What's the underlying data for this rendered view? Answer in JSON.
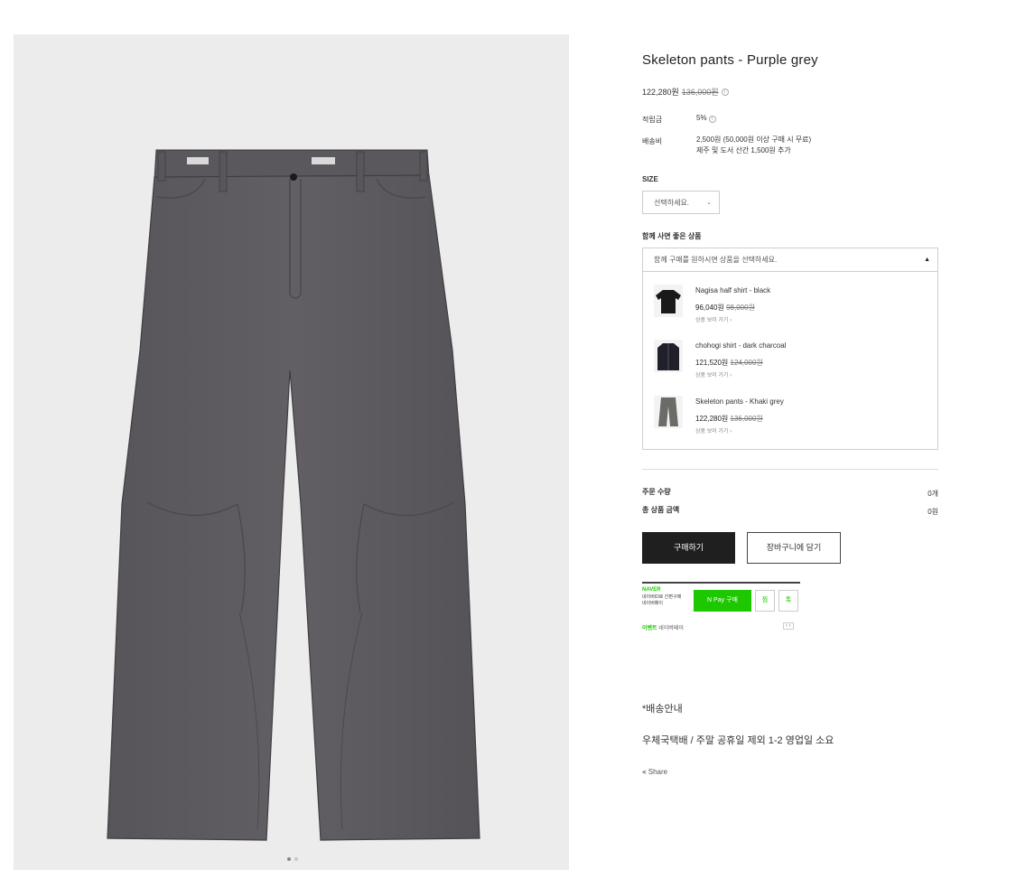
{
  "product": {
    "title": "Skeleton pants - Purple grey",
    "price": "122,280원",
    "original_price": "136,000원",
    "info_mark": "i"
  },
  "meta": {
    "points_label": "적립금",
    "points_value": "5%",
    "shipping_label": "배송비",
    "shipping_line1": "2,500원 (50,000원 이상 구매 시 무료)",
    "shipping_line2": "제주 및 도서 산간 1,500원 추가"
  },
  "size": {
    "label": "SIZE",
    "placeholder": "선택하세요.",
    "chevron": "⌄"
  },
  "related": {
    "label": "함께 사면 좋은 상품",
    "prompt": "함께 구매를 원하시면 상품을 선택하세요.",
    "toggle": "▲",
    "items": [
      {
        "name": "Nagisa half shirt - black",
        "price": "96,040원",
        "original": "98,000원",
        "link": "상품 보러 가기 ›",
        "icon": "shirt-icon"
      },
      {
        "name": "chohogi shirt - dark charcoal",
        "price": "121,520원",
        "original": "124,000원",
        "link": "상품 보러 가기 ›",
        "icon": "shirt-icon"
      },
      {
        "name": "Skeleton pants - Khaki grey",
        "price": "122,280원",
        "original": "136,000원",
        "link": "상품 보러 가기 ›",
        "icon": "pants-icon"
      }
    ]
  },
  "summary": {
    "qty_label": "주문 수량",
    "qty_value": "0개",
    "total_label": "총 상품 금액",
    "total_value": "0원"
  },
  "actions": {
    "buy": "구매하기",
    "cart": "장바구니에 담기"
  },
  "npay": {
    "logo": "NAVER",
    "sub1": "네이버ID로 간편구매",
    "sub2": "네이버페이",
    "button": "N Pay 구매",
    "wish": "찜",
    "talk": "톡",
    "foot_green": "이벤트",
    "foot_gray": "네이버페이",
    "arrows": "‹ ›"
  },
  "shipping_notice": {
    "title": "*배송안내",
    "text": "우체국택배 / 주말 공휴일 제외 1-2 영업일 소요"
  },
  "share": {
    "label": "⪪ Share"
  },
  "colors": {
    "pants": "#5d5b5e",
    "background": "#ececec",
    "buy_button": "#1f1f1f",
    "naver_green": "#1ec800"
  },
  "gallery": {
    "current": 1,
    "total": 2
  }
}
